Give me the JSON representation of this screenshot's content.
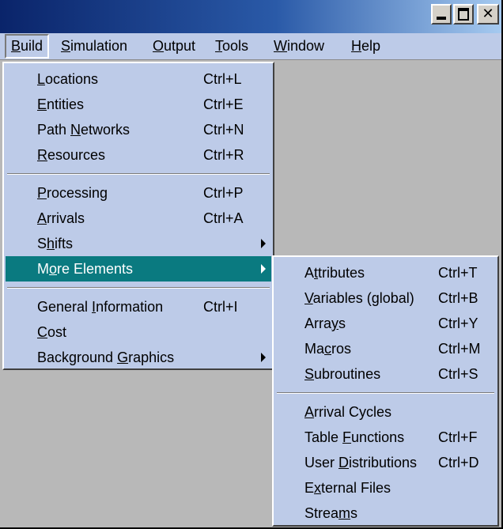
{
  "window": {
    "colors": {
      "menu_bg": "#bdcbe8",
      "highlight": "#0a7a80",
      "client_bg": "#b8b8b8",
      "title_start": "#0a246a",
      "title_end": "#a6caf0"
    }
  },
  "menubar": {
    "items": [
      {
        "pre": "",
        "key": "B",
        "post": "uild"
      },
      {
        "pre": "",
        "key": "S",
        "post": "imulation"
      },
      {
        "pre": "",
        "key": "O",
        "post": "utput"
      },
      {
        "pre": "",
        "key": "T",
        "post": "ools"
      },
      {
        "pre": "",
        "key": "W",
        "post": "indow"
      },
      {
        "pre": "",
        "key": "H",
        "post": "elp"
      }
    ]
  },
  "build_menu": {
    "items": [
      {
        "pre": "",
        "key": "L",
        "post": "ocations",
        "shortcut": "Ctrl+L"
      },
      {
        "pre": "",
        "key": "E",
        "post": "ntities",
        "shortcut": "Ctrl+E"
      },
      {
        "pre": "Path ",
        "key": "N",
        "post": "etworks",
        "shortcut": "Ctrl+N"
      },
      {
        "pre": "",
        "key": "R",
        "post": "esources",
        "shortcut": "Ctrl+R"
      },
      {
        "pre": "",
        "key": "P",
        "post": "rocessing",
        "shortcut": "Ctrl+P"
      },
      {
        "pre": "",
        "key": "A",
        "post": "rrivals",
        "shortcut": "Ctrl+A"
      },
      {
        "pre": "S",
        "key": "h",
        "post": "ifts",
        "shortcut": ""
      },
      {
        "pre": "M",
        "key": "o",
        "post": "re Elements",
        "shortcut": ""
      },
      {
        "pre": "General ",
        "key": "I",
        "post": "nformation",
        "shortcut": "Ctrl+I"
      },
      {
        "pre": "",
        "key": "C",
        "post": "ost",
        "shortcut": ""
      },
      {
        "pre": "Background ",
        "key": "G",
        "post": "raphics",
        "shortcut": ""
      }
    ]
  },
  "more_elements_menu": {
    "items": [
      {
        "pre": "A",
        "key": "t",
        "post": "tributes",
        "shortcut": "Ctrl+T"
      },
      {
        "pre": "",
        "key": "V",
        "post": "ariables (global)",
        "shortcut": "Ctrl+B"
      },
      {
        "pre": "Arra",
        "key": "y",
        "post": "s",
        "shortcut": "Ctrl+Y"
      },
      {
        "pre": "Ma",
        "key": "c",
        "post": "ros",
        "shortcut": "Ctrl+M"
      },
      {
        "pre": "",
        "key": "S",
        "post": "ubroutines",
        "shortcut": "Ctrl+S"
      },
      {
        "pre": "",
        "key": "A",
        "post": "rrival Cycles",
        "shortcut": ""
      },
      {
        "pre": "Table ",
        "key": "F",
        "post": "unctions",
        "shortcut": "Ctrl+F"
      },
      {
        "pre": "User ",
        "key": "D",
        "post": "istributions",
        "shortcut": "Ctrl+D"
      },
      {
        "pre": "E",
        "key": "x",
        "post": "ternal Files",
        "shortcut": ""
      },
      {
        "pre": "Strea",
        "key": "m",
        "post": "s",
        "shortcut": ""
      }
    ]
  }
}
